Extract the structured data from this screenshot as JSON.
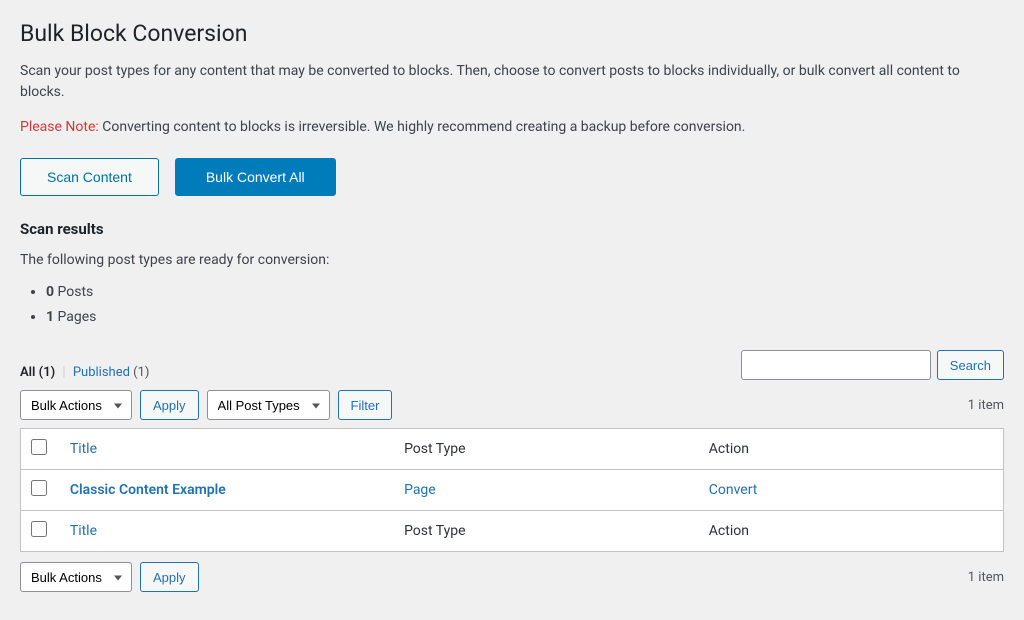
{
  "page": {
    "title": "Bulk Block Conversion",
    "intro": "Scan your post types for any content that may be converted to blocks. Then, choose to convert posts to blocks individually, or bulk convert all content to blocks.",
    "warning_label": "Please Note:",
    "warning_text": " Converting content to blocks is irreversible. We highly recommend creating a backup before conversion."
  },
  "buttons": {
    "scan": "Scan Content",
    "bulk_convert": "Bulk Convert All",
    "apply": "Apply",
    "filter": "Filter",
    "search": "Search"
  },
  "scan_results": {
    "heading": "Scan results",
    "ready_text": "The following post types are ready for conversion:",
    "items": [
      {
        "count": "0",
        "label": " Posts"
      },
      {
        "count": "1",
        "label": " Pages"
      }
    ]
  },
  "subsub": {
    "all_label": "All",
    "all_count": "(1)",
    "published_label": "Published",
    "published_count": "(1)"
  },
  "selects": {
    "bulk_actions": "Bulk Actions",
    "all_post_types": "All Post Types"
  },
  "pagination": {
    "item_count": "1 item"
  },
  "table": {
    "headers": {
      "title": "Title",
      "post_type": "Post Type",
      "action": "Action"
    },
    "rows": [
      {
        "title": "Classic Content Example",
        "post_type": "Page",
        "action": "Convert"
      }
    ]
  }
}
